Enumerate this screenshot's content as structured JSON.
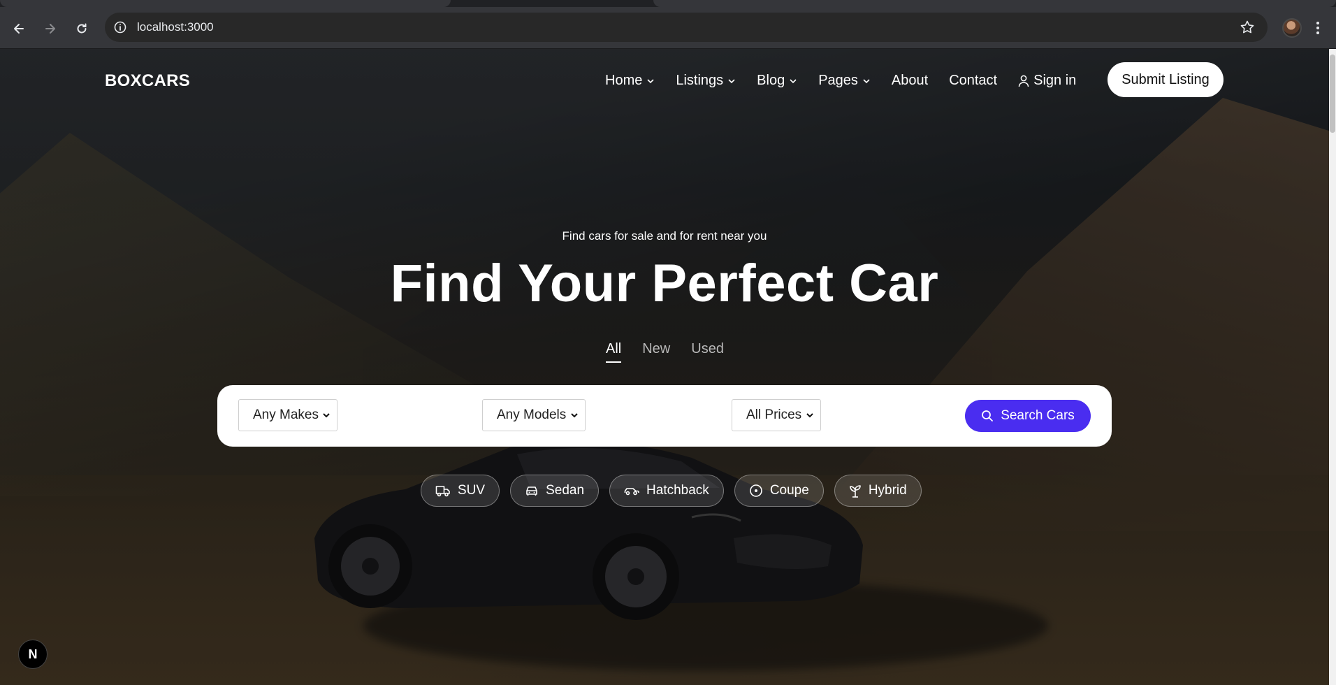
{
  "browser": {
    "url": "localhost:3000",
    "icons": [
      "back-icon",
      "forward-icon",
      "reload-icon",
      "site-info-icon",
      "bookmark-star-icon",
      "profile-avatar",
      "kebab-menu-icon"
    ]
  },
  "header": {
    "logo": "BOXCARS",
    "nav": [
      {
        "label": "Home",
        "dropdown": true
      },
      {
        "label": "Listings",
        "dropdown": true
      },
      {
        "label": "Blog",
        "dropdown": true
      },
      {
        "label": "Pages",
        "dropdown": true
      },
      {
        "label": "About",
        "dropdown": false
      },
      {
        "label": "Contact",
        "dropdown": false
      }
    ],
    "signin_label": "Sign in",
    "submit_label": "Submit Listing"
  },
  "hero": {
    "eyebrow": "Find cars for sale and for rent near you",
    "title": "Find Your Perfect Car",
    "tabs": [
      {
        "label": "All",
        "active": true
      },
      {
        "label": "New",
        "active": false
      },
      {
        "label": "Used",
        "active": false
      }
    ]
  },
  "search": {
    "makes": "Any Makes",
    "models": "Any Models",
    "prices": "All Prices",
    "button_label": "Search Cars",
    "accent_color": "#4a2df0"
  },
  "categories": [
    {
      "label": "SUV",
      "icon": "truck-icon"
    },
    {
      "label": "Sedan",
      "icon": "car-front-icon"
    },
    {
      "label": "Hatchback",
      "icon": "car-side-icon"
    },
    {
      "label": "Coupe",
      "icon": "disc-icon"
    },
    {
      "label": "Hybrid",
      "icon": "plant-icon"
    }
  ],
  "devtools_badge": "N"
}
